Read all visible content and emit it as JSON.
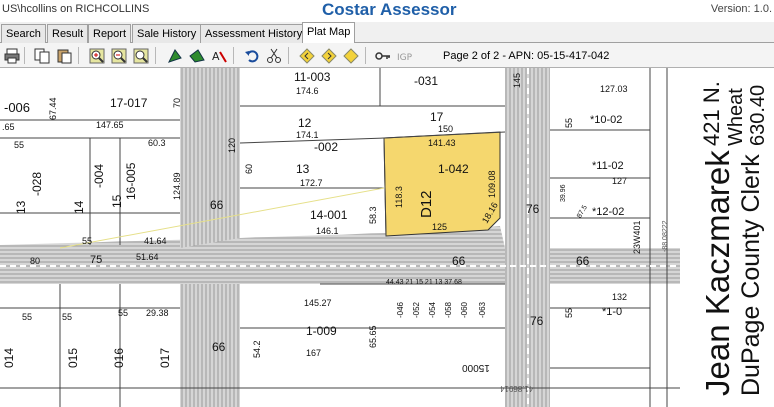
{
  "titlebar": {
    "user": "US\\hcollins on RICHCOLLINS",
    "app_title": "Costar Assessor",
    "version": "Version: 1.0."
  },
  "tabs": [
    {
      "label": "Search",
      "active": false
    },
    {
      "label": "Result",
      "active": false
    },
    {
      "label": "Report",
      "active": false
    },
    {
      "label": "Sale History",
      "active": false
    },
    {
      "label": "Assessment History",
      "active": false
    },
    {
      "label": "Plat Map",
      "active": true
    }
  ],
  "toolbar": {
    "page_info": "Page 2 of 2 - APN: 05-15-417-042",
    "icons": [
      "print-icon",
      "copy-icon",
      "paste-icon",
      "zoom-in-icon",
      "zoom-out-icon",
      "zoom-fit-icon",
      "pan-icon",
      "select-icon",
      "text-icon",
      "undo-icon",
      "cut-icon",
      "prev-page-icon",
      "next-page-icon",
      "key-icon",
      "info-icon"
    ]
  },
  "colors": {
    "highlight": "#f5d76e",
    "road": "#bdbdbd",
    "title_blue": "#1f5fa8"
  },
  "map": {
    "selected_parcel": "1-042",
    "selected_block": "D12",
    "labels": [
      {
        "text": "-006",
        "name": "parcel-label"
      },
      {
        "text": "67.44",
        "name": "dimension-label"
      },
      {
        "text": "17-017",
        "name": "parcel-label"
      },
      {
        "text": "70",
        "name": "dimension-label"
      },
      {
        "text": ".65",
        "name": "dimension-label"
      },
      {
        "text": "147.65",
        "name": "dimension-label"
      },
      {
        "text": "11-003",
        "name": "parcel-label"
      },
      {
        "text": "174.6",
        "name": "dimension-label"
      },
      {
        "text": "-031",
        "name": "parcel-label"
      },
      {
        "text": "127.03",
        "name": "dimension-label"
      },
      {
        "text": "12",
        "name": "parcel-label"
      },
      {
        "text": "174.1",
        "name": "dimension-label"
      },
      {
        "text": "17",
        "name": "parcel-label"
      },
      {
        "text": "150",
        "name": "dimension-label"
      },
      {
        "text": "120",
        "name": "dimension-label"
      },
      {
        "text": "-002",
        "name": "parcel-label"
      },
      {
        "text": "141.43",
        "name": "dimension-label"
      },
      {
        "text": "1-042",
        "name": "parcel-label"
      },
      {
        "text": "13",
        "name": "parcel-label"
      },
      {
        "text": "60",
        "name": "dimension-label"
      },
      {
        "text": "172.7",
        "name": "dimension-label"
      },
      {
        "text": "118.3",
        "name": "dimension-label"
      },
      {
        "text": "D12",
        "name": "block-label"
      },
      {
        "text": "109.08",
        "name": "dimension-label"
      },
      {
        "text": "14-001",
        "name": "parcel-label"
      },
      {
        "text": "58.3",
        "name": "dimension-label"
      },
      {
        "text": "146.1",
        "name": "dimension-label"
      },
      {
        "text": "125",
        "name": "dimension-label"
      },
      {
        "text": "18.16",
        "name": "dimension-label"
      },
      {
        "text": "76",
        "name": "road-label"
      },
      {
        "text": "55",
        "name": "dimension-label"
      },
      {
        "text": "60.3",
        "name": "dimension-label"
      },
      {
        "text": "-028",
        "name": "parcel-label"
      },
      {
        "text": "-004",
        "name": "parcel-label"
      },
      {
        "text": "16-005",
        "name": "parcel-label"
      },
      {
        "text": "124.89",
        "name": "dimension-label"
      },
      {
        "text": "13",
        "name": "parcel-label"
      },
      {
        "text": "14",
        "name": "parcel-label"
      },
      {
        "text": "15",
        "name": "parcel-label"
      },
      {
        "text": "66",
        "name": "road-label"
      },
      {
        "text": "55",
        "name": "dimension-label"
      },
      {
        "text": "41.64",
        "name": "dimension-label"
      },
      {
        "text": "80",
        "name": "dimension-label"
      },
      {
        "text": "75",
        "name": "road-label"
      },
      {
        "text": "51.64",
        "name": "dimension-label"
      },
      {
        "text": "66",
        "name": "road-label"
      },
      {
        "text": "66",
        "name": "road-label"
      },
      {
        "text": "145",
        "name": "dimension-label"
      },
      {
        "text": "55",
        "name": "dimension-label"
      },
      {
        "text": "*10-02",
        "name": "parcel-label"
      },
      {
        "text": "*11-02",
        "name": "parcel-label"
      },
      {
        "text": "127",
        "name": "dimension-label"
      },
      {
        "text": "*12-02",
        "name": "parcel-label"
      },
      {
        "text": "39.96",
        "name": "dimension-label"
      },
      {
        "text": "87.5",
        "name": "dimension-label"
      },
      {
        "text": "23W401",
        "name": "address-label"
      },
      {
        "text": "-88.08222",
        "name": "coordinate-label"
      },
      {
        "text": "145.27",
        "name": "dimension-label"
      },
      {
        "text": "1-009",
        "name": "parcel-label"
      },
      {
        "text": "54.2",
        "name": "dimension-label"
      },
      {
        "text": "167",
        "name": "dimension-label"
      },
      {
        "text": "65.65",
        "name": "dimension-label"
      },
      {
        "text": "55",
        "name": "dimension-label"
      },
      {
        "text": "55",
        "name": "dimension-label"
      },
      {
        "text": "55",
        "name": "dimension-label"
      },
      {
        "text": "29.38",
        "name": "dimension-label"
      },
      {
        "text": "014",
        "name": "parcel-label"
      },
      {
        "text": "015",
        "name": "parcel-label"
      },
      {
        "text": "016",
        "name": "parcel-label"
      },
      {
        "text": "017",
        "name": "parcel-label"
      },
      {
        "text": "66",
        "name": "road-label"
      },
      {
        "text": "76",
        "name": "road-label"
      },
      {
        "text": "132",
        "name": "dimension-label"
      },
      {
        "text": "*1-0",
        "name": "parcel-label"
      },
      {
        "text": "55",
        "name": "dimension-label"
      },
      {
        "text": "15000",
        "name": "address-label"
      },
      {
        "text": "41.86914",
        "name": "coordinate-label"
      },
      {
        "text": "44.43 21 15 21 13 37.68",
        "name": "dimension-label"
      },
      {
        "text": "-046",
        "name": "parcel-label"
      },
      {
        "text": "-052",
        "name": "parcel-label"
      },
      {
        "text": "-054",
        "name": "parcel-label"
      },
      {
        "text": "-058",
        "name": "parcel-label"
      },
      {
        "text": "-060",
        "name": "parcel-label"
      },
      {
        "text": "-063",
        "name": "parcel-label"
      }
    ]
  },
  "clerk": {
    "name": "Jean Kaczmarek",
    "title": "DuPage County Clerk",
    "addr1": "421 N.",
    "addr2": "Wheat",
    "phone": "630.40"
  }
}
